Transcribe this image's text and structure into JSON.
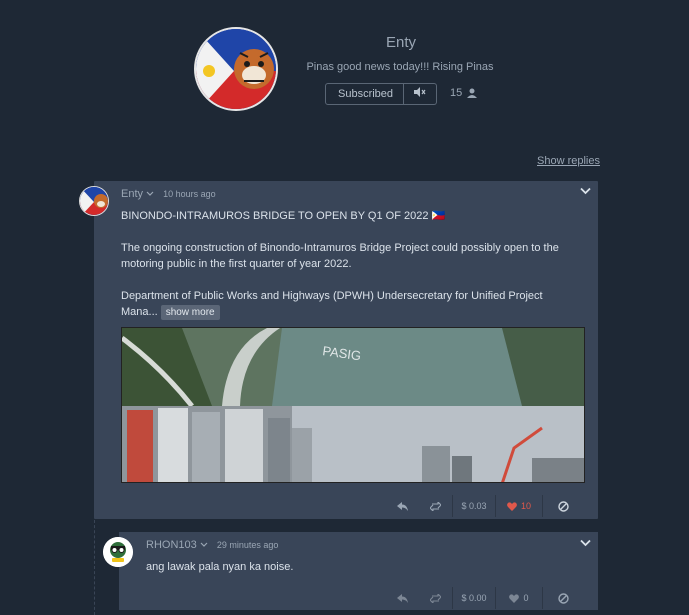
{
  "profile": {
    "name": "Enty",
    "bio": "Pinas good news today!!! Rising Pinas",
    "subscribe_label": "Subscribed",
    "mute_icon": "mute-icon",
    "subscriber_count": "15",
    "subscriber_icon": "user-icon"
  },
  "thread": {
    "show_replies": "Show replies"
  },
  "post": {
    "author": "Enty",
    "time": "10 hours ago",
    "title": "BINONDO-INTRAMUROS BRIDGE TO OPEN BY Q1 OF 2022 🇵🇭",
    "paragraph1": "The ongoing construction of Binondo-Intramuros Bridge Project could possibly open to the motoring public in the first quarter of year 2022.",
    "paragraph2": "Department of Public Works and Highways (DPWH) Undersecretary for Unified Project Mana...",
    "show_more": "show more",
    "image_text": "PASIG",
    "actions": {
      "reward": "$ 0.03",
      "likes": "10"
    }
  },
  "reply": {
    "author": "RHON103",
    "time": "29 minutes ago",
    "text": "ang lawak pala nyan ka noise.",
    "actions": {
      "reward": "$ 0.00",
      "likes": "0"
    }
  },
  "colors": {
    "background": "#1e2835",
    "card": "#394558",
    "liked": "#e0584b"
  }
}
